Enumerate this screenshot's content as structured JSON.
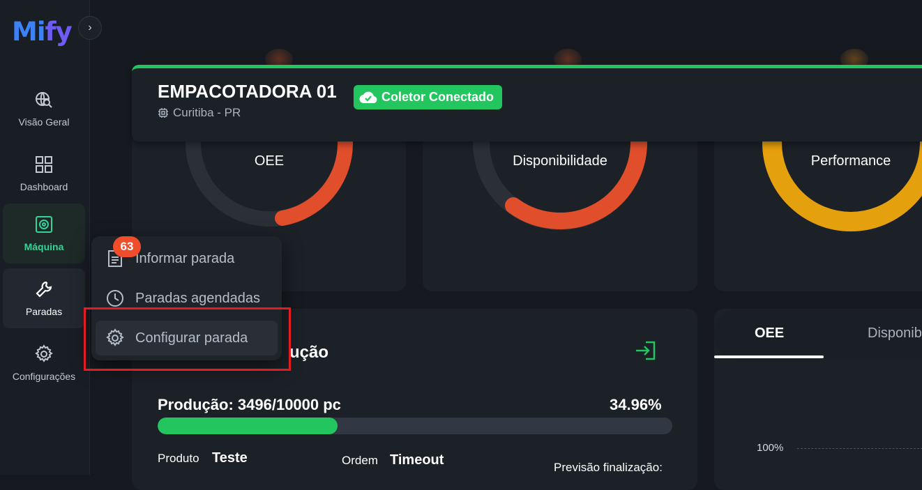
{
  "app": {
    "logo": "Mify",
    "logo_part1": "Mi",
    "logo_part2": "fy",
    "collapse_icon": "chevron-right-icon"
  },
  "sidebar": {
    "items": [
      {
        "label": "Visão Geral",
        "icon": "globe-search-icon"
      },
      {
        "label": "Dashboard",
        "icon": "grid-icon"
      },
      {
        "label": "Máquina",
        "icon": "machine-icon",
        "active": true
      },
      {
        "label": "Paradas",
        "icon": "wrench-icon"
      },
      {
        "label": "Configurações",
        "icon": "gear-icon"
      }
    ]
  },
  "machine": {
    "name": "EMPACOTADORA 01",
    "location": "Curitiba - PR",
    "status": "Coletor Conectado",
    "colors": {
      "accent": "#22c55e"
    }
  },
  "gauges": [
    {
      "label": "OEE",
      "color": "#e04e2c"
    },
    {
      "label": "Disponibilidade",
      "color": "#e04e2c"
    },
    {
      "label": "Performance",
      "color": "#e5a00d"
    }
  ],
  "production": {
    "title_visible": "ução",
    "label": "Produção: 3496/10000 pc",
    "percent_text": "34.96%",
    "progress": 0.3496,
    "produto_label": "Produto",
    "produto_value": "Teste",
    "ordem_label": "Ordem",
    "ordem_value": "Timeout",
    "previsao_label": "Previsão finalização:"
  },
  "chart_tabs": {
    "items": [
      "OEE",
      "Disponib"
    ],
    "active": "OEE",
    "y_tick": "100%"
  },
  "menu": {
    "badge": "63",
    "items": [
      {
        "label": "Informar parada",
        "icon": "document-icon"
      },
      {
        "label": "Paradas agendadas",
        "icon": "clock-icon"
      },
      {
        "label": "Configurar parada",
        "icon": "gear-icon",
        "highlighted": true
      }
    ]
  }
}
